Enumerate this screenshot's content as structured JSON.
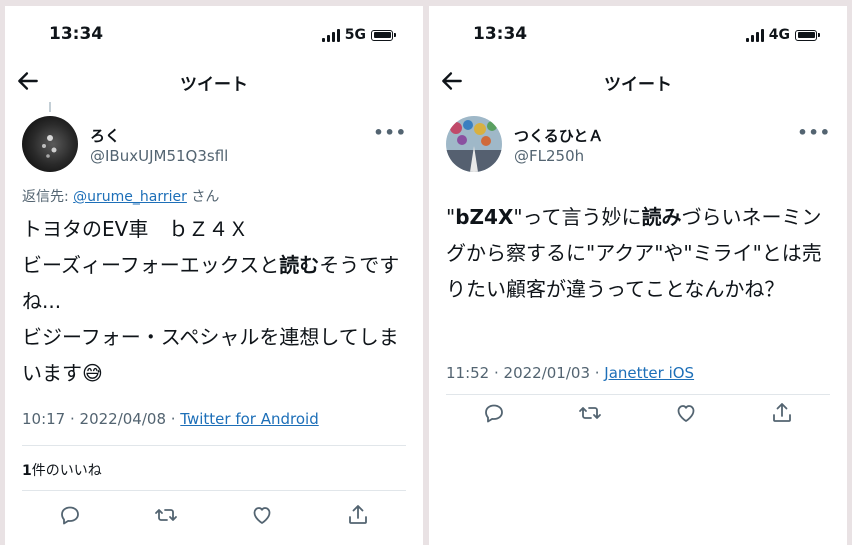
{
  "left": {
    "status": {
      "time": "13:34",
      "network": "5G"
    },
    "nav": {
      "title": "ツイート"
    },
    "tweet": {
      "display_name": "ろく",
      "handle": "@IBuxUJM51Q3sfll",
      "reply_prefix": "返信先: ",
      "reply_to": "@urume_harrier",
      "reply_suffix": "さん",
      "text_1": "トヨタのEV車　ｂＺ４Ｘ\nビーズィーフォーエックスと",
      "text_bold": "読む",
      "text_2": "そうですね...\nビジーフォー・スペシャルを連想してしまいます😅",
      "timestamp": "10:17 · 2022/04/08 · ",
      "source": "Twitter for Android",
      "like_count": "1",
      "like_label": "件のいいね"
    },
    "actions": [
      "reply-icon",
      "retweet-icon",
      "like-icon",
      "share-icon"
    ]
  },
  "right": {
    "status": {
      "time": "13:34",
      "network": "4G"
    },
    "nav": {
      "title": "ツイート"
    },
    "tweet": {
      "display_name": "つくるひとＡ",
      "handle": "@FL250h",
      "text_q1": "\"",
      "text_bold_1": "bZ4X",
      "text_mid": "\"って言う妙に",
      "text_bold_2": "読み",
      "text_rest": "づらいネーミングから察するに\"アクア\"や\"ミライ\"とは売りたい顧客が違うってことなんかね？",
      "timestamp": "11:52 · 2022/01/03 · ",
      "source": "Janetter iOS"
    },
    "actions": [
      "reply-icon",
      "retweet-icon",
      "like-icon",
      "share-icon"
    ]
  },
  "colors": {
    "text": "#0f1419",
    "secondary": "#536471",
    "link": "#1d6fb8",
    "background": "#e9e2e4"
  }
}
